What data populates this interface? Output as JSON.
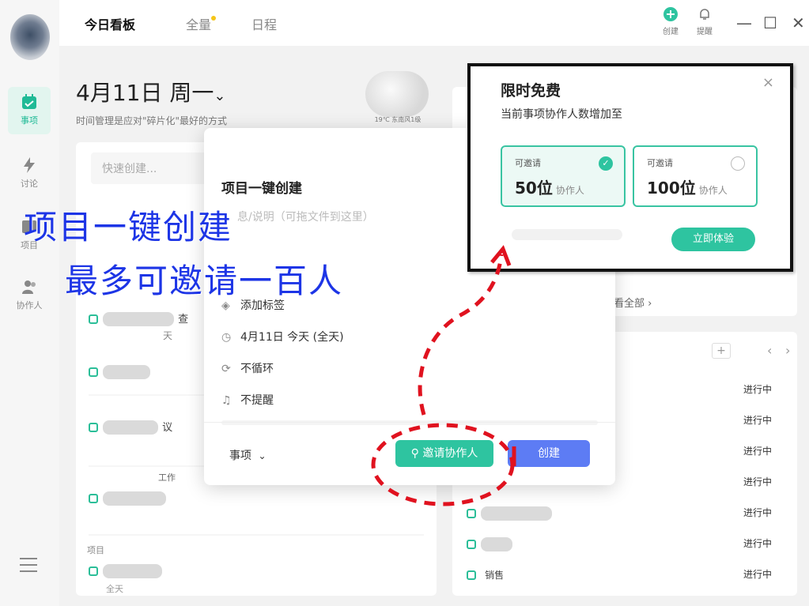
{
  "header": {
    "tabs": [
      {
        "label": "今日看板",
        "active": true
      },
      {
        "label": "全量",
        "active": false
      },
      {
        "label": "日程",
        "active": false
      }
    ],
    "actions": [
      {
        "label": "创建",
        "icon": "plus-circle-icon"
      },
      {
        "label": "提醒",
        "icon": "bell-icon"
      }
    ],
    "window_controls": [
      "—",
      "☐",
      "✕"
    ]
  },
  "sidebar": {
    "items": [
      {
        "label": "事项",
        "icon": "calendar-check-icon",
        "active": true
      },
      {
        "label": "讨论",
        "icon": "lightning-icon",
        "active": false
      },
      {
        "label": "项目",
        "icon": "folder-icon",
        "active": false
      },
      {
        "label": "协作人",
        "icon": "people-icon",
        "active": false
      }
    ]
  },
  "dashboard": {
    "date": "4月11日 周一",
    "chevron": "⌄",
    "subtitle": "时间管理是应对\"碎片化\"最好的方式",
    "weather": "19℃ 东南风1级",
    "quick_create_placeholder": "快速创建...",
    "see_all": "看全部 ›",
    "left_fragments": [
      "查",
      "天",
      "议",
      "工作",
      "项目",
      "全天"
    ],
    "right_fragment": "销售",
    "pager": [
      "+",
      "‹",
      "›"
    ]
  },
  "status_list": [
    "进行中",
    "进行中",
    "进行中",
    "进行中",
    "进行中",
    "进行中",
    "进行中"
  ],
  "dialog": {
    "title": "项目一键创建",
    "description_placeholder": "息/说明（可拖文件到这里）",
    "options": [
      {
        "icon": "tag-icon",
        "glyph": "◈",
        "label": "添加标签"
      },
      {
        "icon": "clock-icon",
        "glyph": "◷",
        "label": "4月11日 今天 (全天)"
      },
      {
        "icon": "repeat-icon",
        "glyph": "⟳",
        "label": "不循环"
      },
      {
        "icon": "bell-icon",
        "glyph": "♫",
        "label": "不提醒"
      }
    ],
    "type_label": "事项",
    "invite_label": "邀请协作人",
    "create_label": "创建"
  },
  "promo": {
    "title": "限时免费",
    "subtitle": "当前事项协作人数增加至",
    "plans": [
      {
        "label": "可邀请",
        "value": "50位",
        "unit": "协作人",
        "selected": true
      },
      {
        "label": "可邀请",
        "value": "100位",
        "unit": "协作人",
        "selected": false
      }
    ],
    "trial_button": "立即体验",
    "close": "×"
  },
  "annotation": {
    "line1": "项目一键创建",
    "line2": "最多可邀请一百人",
    "color": "#1d35e6",
    "arrow_color": "#e0121f"
  },
  "colors": {
    "accent": "#2ec4a0",
    "primary": "#5d7cf4"
  }
}
